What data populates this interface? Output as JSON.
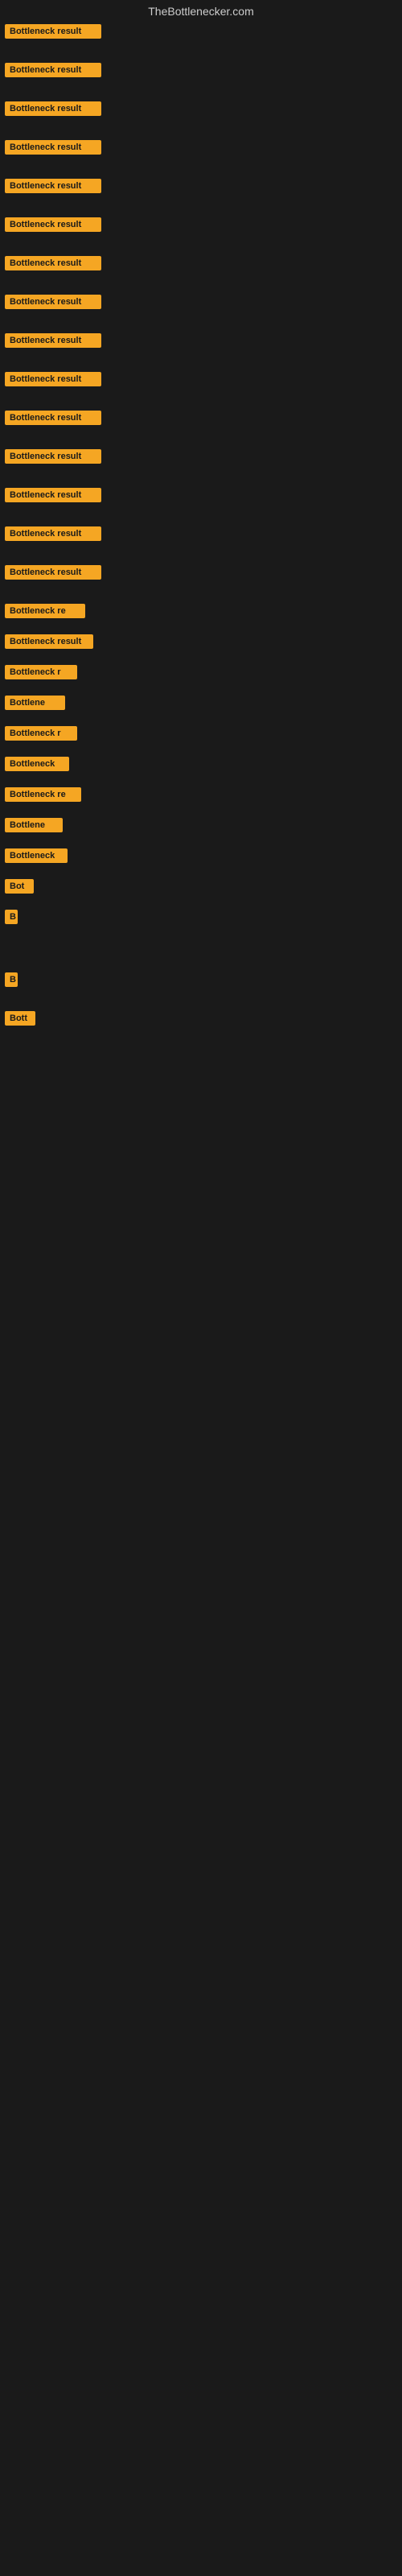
{
  "site": {
    "title": "TheBottlenecker.com"
  },
  "items": [
    {
      "label": "Bottleneck result",
      "width": 120,
      "gap_after": 30
    },
    {
      "label": "Bottleneck result",
      "width": 120,
      "gap_after": 30
    },
    {
      "label": "Bottleneck result",
      "width": 120,
      "gap_after": 30
    },
    {
      "label": "Bottleneck result",
      "width": 120,
      "gap_after": 30
    },
    {
      "label": "Bottleneck result",
      "width": 120,
      "gap_after": 30
    },
    {
      "label": "Bottleneck result",
      "width": 120,
      "gap_after": 30
    },
    {
      "label": "Bottleneck result",
      "width": 120,
      "gap_after": 30
    },
    {
      "label": "Bottleneck result",
      "width": 120,
      "gap_after": 30
    },
    {
      "label": "Bottleneck result",
      "width": 120,
      "gap_after": 30
    },
    {
      "label": "Bottleneck result",
      "width": 120,
      "gap_after": 30
    },
    {
      "label": "Bottleneck result",
      "width": 120,
      "gap_after": 30
    },
    {
      "label": "Bottleneck result",
      "width": 120,
      "gap_after": 30
    },
    {
      "label": "Bottleneck result",
      "width": 120,
      "gap_after": 30
    },
    {
      "label": "Bottleneck result",
      "width": 120,
      "gap_after": 30
    },
    {
      "label": "Bottleneck result",
      "width": 120,
      "gap_after": 30
    },
    {
      "label": "Bottleneck re",
      "width": 100,
      "gap_after": 20
    },
    {
      "label": "Bottleneck result",
      "width": 110,
      "gap_after": 20
    },
    {
      "label": "Bottleneck r",
      "width": 90,
      "gap_after": 20
    },
    {
      "label": "Bottlene",
      "width": 75,
      "gap_after": 20
    },
    {
      "label": "Bottleneck r",
      "width": 90,
      "gap_after": 20
    },
    {
      "label": "Bottleneck",
      "width": 80,
      "gap_after": 20
    },
    {
      "label": "Bottleneck re",
      "width": 95,
      "gap_after": 20
    },
    {
      "label": "Bottlene",
      "width": 72,
      "gap_after": 20
    },
    {
      "label": "Bottleneck",
      "width": 78,
      "gap_after": 20
    },
    {
      "label": "Bot",
      "width": 36,
      "gap_after": 20
    },
    {
      "label": "B",
      "width": 16,
      "gap_after": 30
    },
    {
      "label": "",
      "width": 0,
      "gap_after": 60
    },
    {
      "label": "B",
      "width": 16,
      "gap_after": 30
    },
    {
      "label": "Bott",
      "width": 38,
      "gap_after": 20
    }
  ]
}
